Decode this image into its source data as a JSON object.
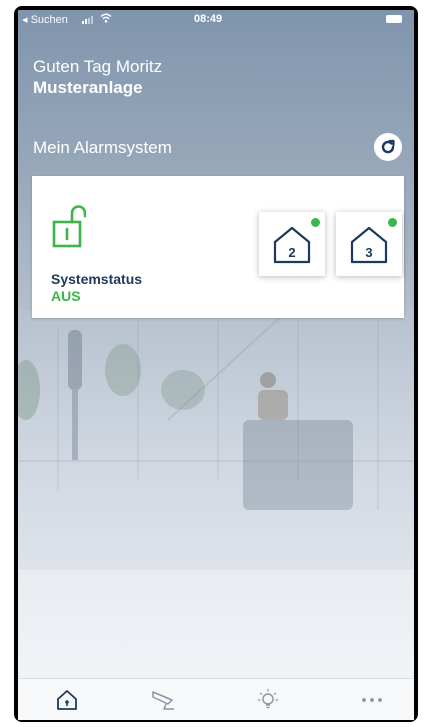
{
  "status_bar": {
    "back_label": "◂ Suchen",
    "time": "08:49"
  },
  "greeting": {
    "line1": "Guten Tag Moritz",
    "line2": "Musteranlage"
  },
  "section": {
    "title": "Mein Alarmsystem"
  },
  "system": {
    "status_label": "Systemstatus",
    "status_value": "AUS"
  },
  "zones": [
    {
      "number": "2",
      "online": true
    },
    {
      "number": "3",
      "online": true
    }
  ],
  "tabs": [
    {
      "icon": "home-alarm-icon"
    },
    {
      "icon": "camera-icon"
    },
    {
      "icon": "lightbulb-icon"
    },
    {
      "icon": "more-icon"
    }
  ],
  "colors": {
    "accent_green": "#3cb54a",
    "navy": "#1b3a5c"
  }
}
